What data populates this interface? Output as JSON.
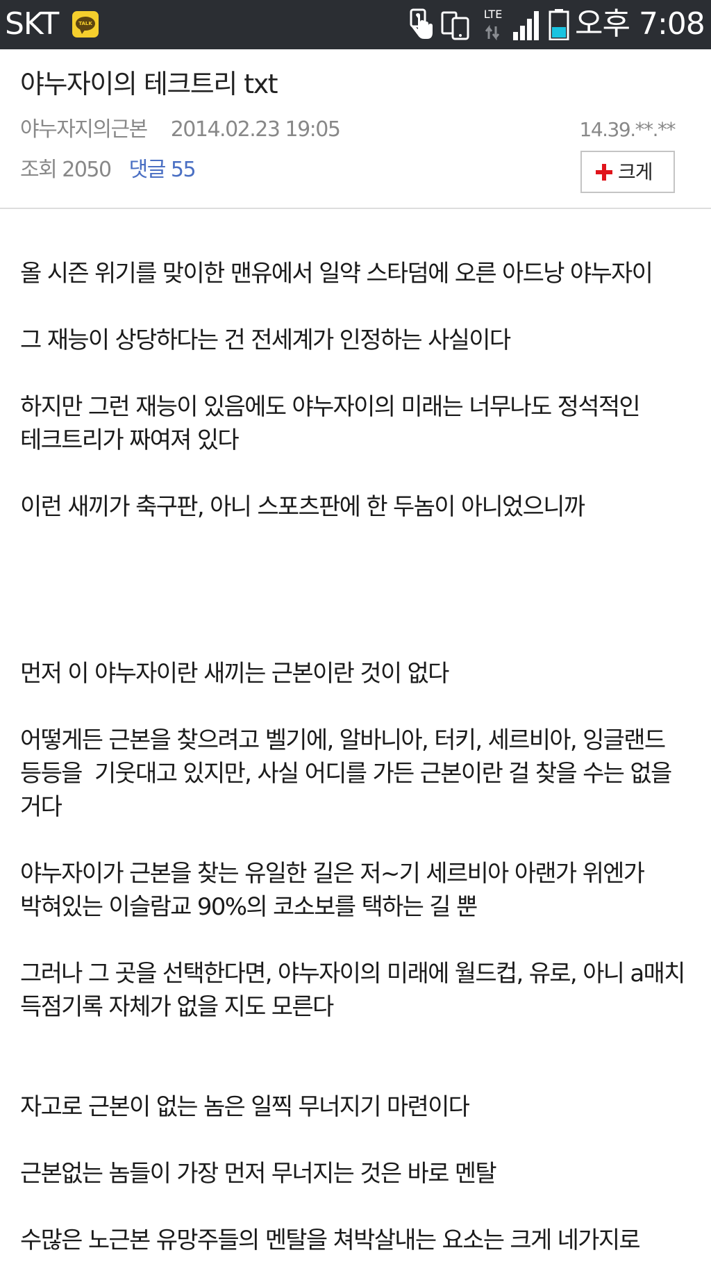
{
  "status_bar": {
    "carrier": "SKT",
    "talk_label": "TALK",
    "network": "LTE",
    "time": "오후 7:08",
    "icons": [
      "kakaotalk-icon",
      "touch-icon",
      "devices-icon",
      "lte-icon",
      "signal-icon",
      "battery-icon"
    ],
    "colors": {
      "background": "#2b2e33",
      "talk_yellow": "#f5cf2d",
      "battery_level": "#19c3e0"
    }
  },
  "post": {
    "title": "야누자이의 테크트리 txt",
    "author": "야누자지의근본",
    "date": "2014.02.23 19:05",
    "ip": "14.39.**.**",
    "views_label": "조회",
    "views": "2050",
    "comments_label": "댓글",
    "comments": "55",
    "zoom_label": "크게",
    "colors": {
      "comments": "#4a6fc3",
      "zoom_plus": "#e0141b",
      "meta": "#888888"
    }
  },
  "body": {
    "paragraphs": [
      "올 시즌 위기를 맞이한 맨유에서 일약 스타덤에 오른 아드낭 야누자이",
      "",
      "그 재능이 상당하다는 건 전세계가 인정하는 사실이다",
      "",
      "하지만 그런 재능이 있음에도 야누자이의 미래는 너무나도 정석적인 테크트리가 짜여져 있다",
      "",
      "이런 새끼가 축구판, 아니 스포츠판에 한 두놈이 아니었으니까",
      "",
      "",
      "",
      "",
      "먼저 이 야누자이란 새끼는 근본이란 것이 없다",
      "",
      "어떻게든 근본을 찾으려고 벨기에, 알바니아, 터키, 세르비아, 잉글랜드 등등을  기웃대고 있지만, 사실 어디를 가든 근본이란 걸 찾을 수는 없을 거다",
      "",
      "야누자이가 근본을 찾는 유일한 길은 저~기 세르비아 아랜가 위엔가 박혀있는 이슬람교 90%의 코소보를 택하는 길 뿐",
      "",
      "그러나 그 곳을 선택한다면, 야누자이의 미래에 월드컵, 유로, 아니 a매치 득점기록 자체가 없을 지도 모른다",
      "",
      "",
      "자고로 근본이 없는 놈은 일찍 무너지기 마련이다",
      "",
      "근본없는 놈들이 가장 먼저 무너지는 것은 바로 멘탈",
      "",
      "수많은 노근본 유망주들의 멘탈을 쳐박살내는 요소는 크게 네가지로"
    ]
  }
}
